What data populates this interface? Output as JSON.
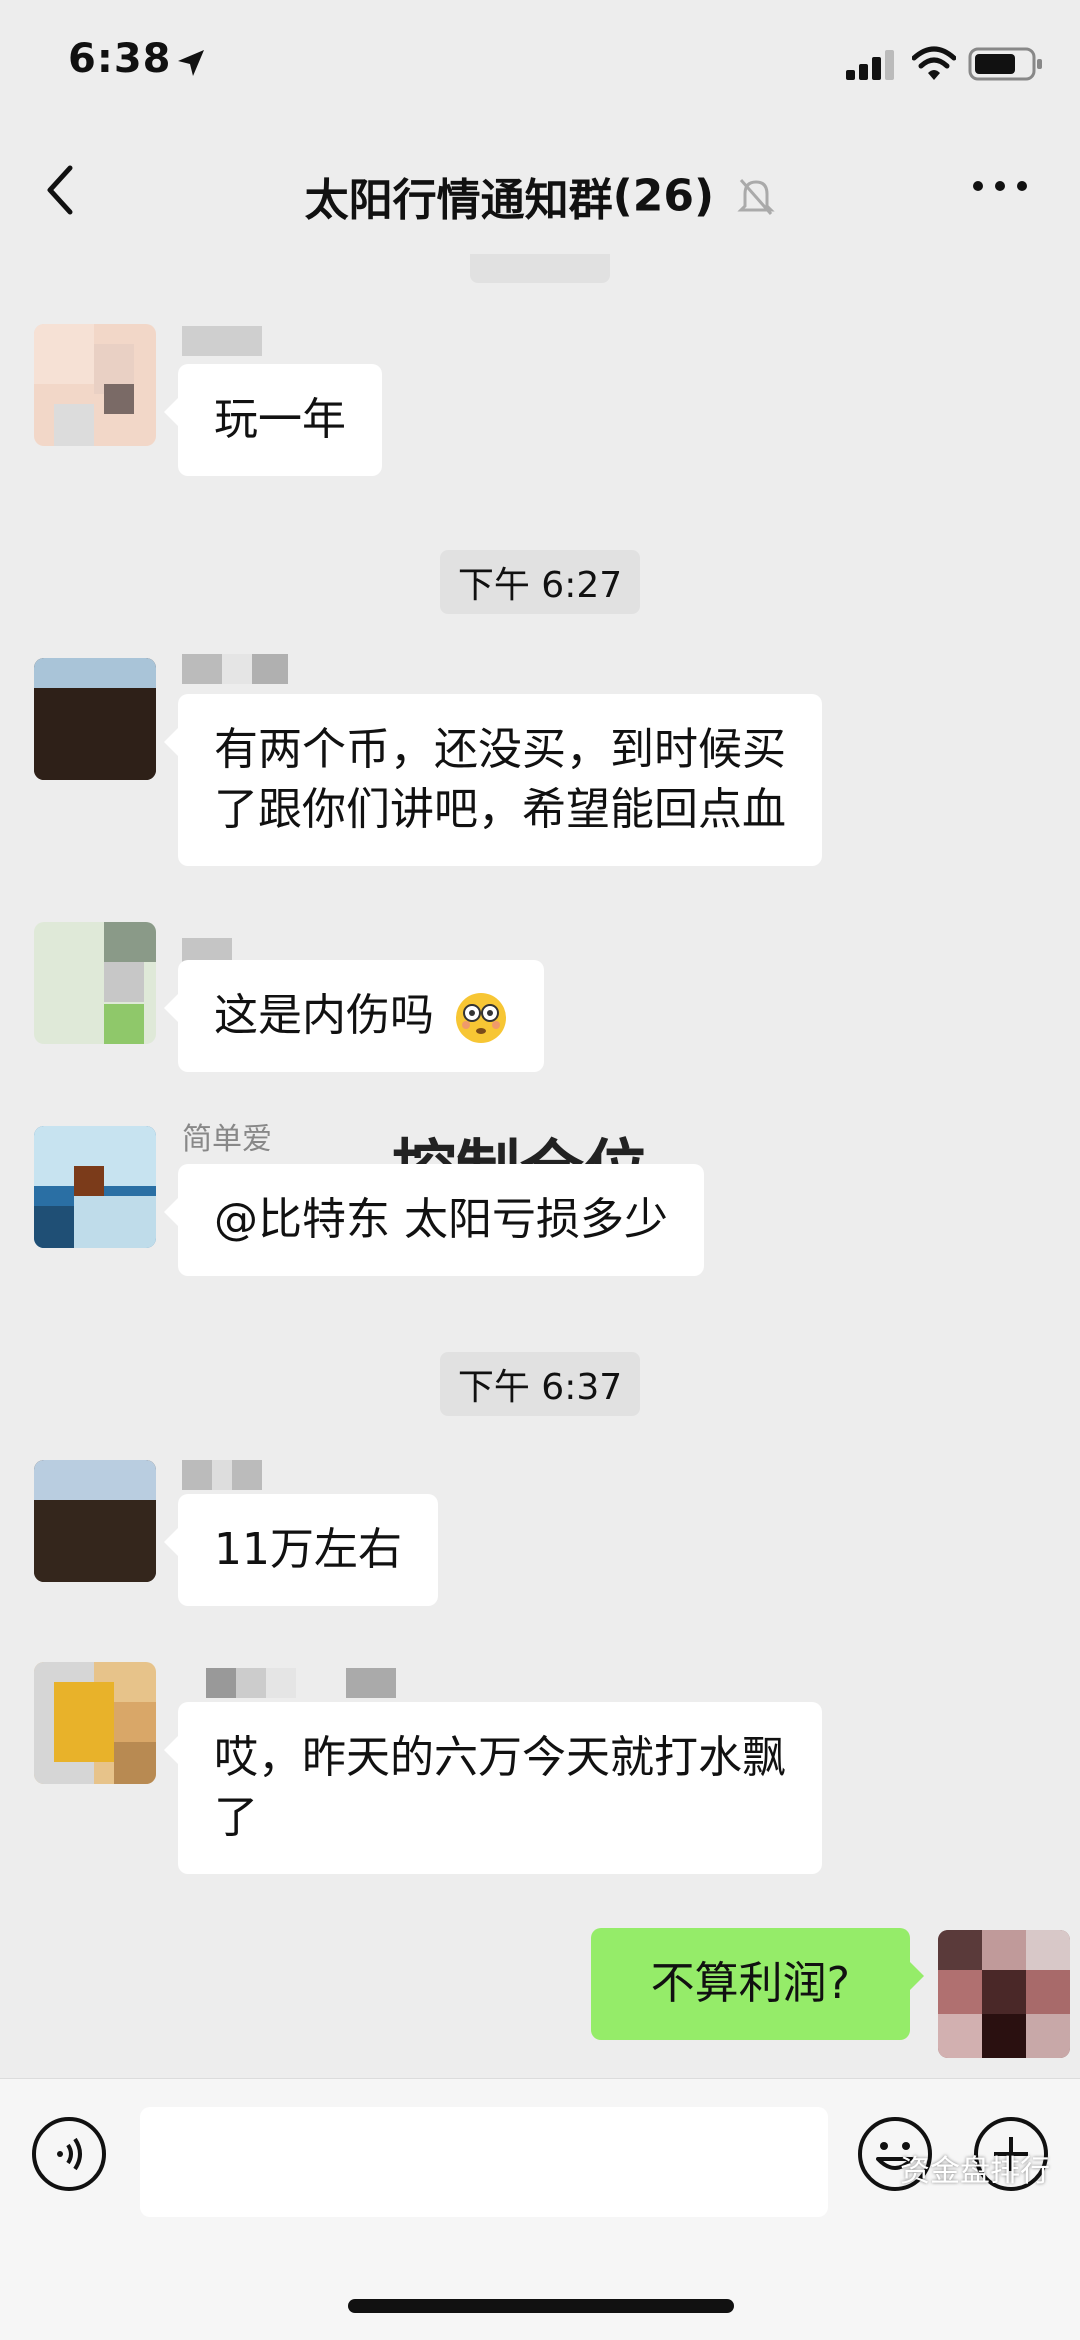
{
  "status_bar": {
    "time": "6:38"
  },
  "header": {
    "title": "太阳行情通知群",
    "member_count": "(26)"
  },
  "messages": {
    "m1": {
      "text": "玩一年"
    },
    "t1": {
      "time": "下午 6:27"
    },
    "m2": {
      "line1": "有两个币，还没买，到时候买",
      "line2": "了跟你们讲吧，希望能回点血"
    },
    "m3": {
      "text": "这是内伤吗"
    },
    "m4": {
      "sender": "简单爱",
      "text": "@比特东 太阳亏损多少"
    },
    "overlay_text": "控制仓位",
    "t2": {
      "time": "下午 6:37"
    },
    "m5": {
      "text": "11万左右"
    },
    "m6": {
      "line1": "哎，昨天的六万今天就打水飘",
      "line2": "了"
    },
    "m7": {
      "text": "不算利润?"
    }
  },
  "watermark": "资金盘排行",
  "colors": {
    "background": "#ededed",
    "incoming_bubble": "#ffffff",
    "outgoing_bubble": "#95ec69"
  }
}
